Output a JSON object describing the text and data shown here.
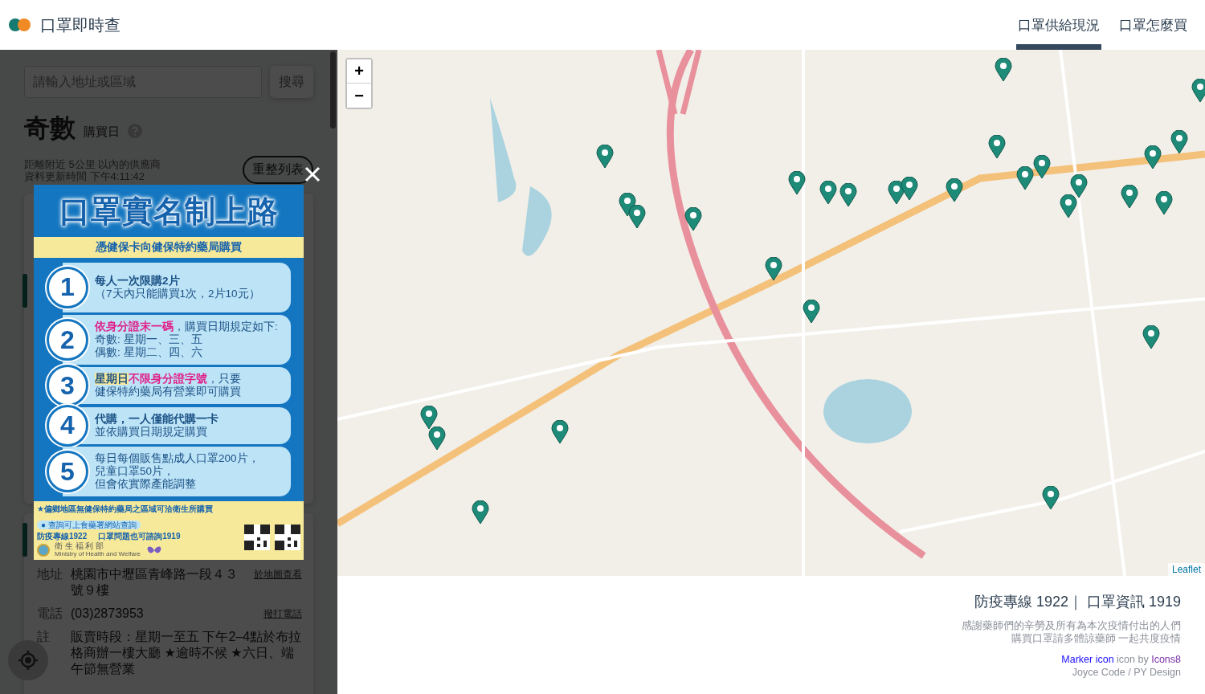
{
  "header": {
    "title": "口罩即時查",
    "nav": [
      {
        "label": "口罩供給現況",
        "selected": true
      },
      {
        "label": "口罩怎麼買",
        "selected": false
      }
    ]
  },
  "sidebar": {
    "search": {
      "placeholder": "請輸入地址或區域",
      "button": "搜尋"
    },
    "day": "奇數",
    "day_label": "購買日",
    "info": [
      "距離附近 5公里 以內的供應商",
      "資料更新時間 下午4:11:42"
    ],
    "refresh": "重整列表",
    "store": {
      "rows": [
        {
          "label": "地址",
          "value": "桃園市中壢區青峰路一段４３號９樓",
          "action": "於地圖查看"
        },
        {
          "label": "電話",
          "value": "(03)2873953",
          "action": "撥打電話"
        },
        {
          "label": "註",
          "value": "販賣時段：星期一至五 下午2–4點於布拉格商辦一樓大廳 ★逾時不候 ★六日、端午節無營業"
        }
      ]
    }
  },
  "modal": {
    "title": "口罩實名制上路",
    "subtitle": "憑健保卡向健保特約藥局購買",
    "items": [
      {
        "number": "1",
        "lines": [
          [
            {
              "text": "每人一次限購2片",
              "kind": "strong"
            }
          ],
          [
            {
              "text": "（7天內只能購買1次，2片10元）",
              "kind": "normal"
            }
          ]
        ]
      },
      {
        "number": "2",
        "lines": [
          [
            {
              "text": "依身分證末一碼",
              "kind": "accent"
            },
            {
              "text": "，購買日期規定如下:",
              "kind": "normal"
            }
          ],
          [
            {
              "text": "奇數: 星期一、三、五",
              "kind": "normal"
            }
          ],
          [
            {
              "text": "偶數: 星期二、四、六",
              "kind": "normal"
            }
          ]
        ]
      },
      {
        "number": "3",
        "lines": [
          [
            {
              "text": "星期日",
              "kind": "highlight"
            },
            {
              "text": "不限身分證字號",
              "kind": "accent"
            },
            {
              "text": "，只要",
              "kind": "normal"
            }
          ],
          [
            {
              "text": "健保特約藥局有營業即可購買",
              "kind": "normal"
            }
          ]
        ]
      },
      {
        "number": "4",
        "lines": [
          [
            {
              "text": "代購，一人僅能代購一卡",
              "kind": "strong"
            }
          ],
          [
            {
              "text": "並依購買日期規定購買",
              "kind": "normal"
            }
          ]
        ]
      },
      {
        "number": "5",
        "lines": [
          [
            {
              "text": "每日每個販售點成人口罩200片，",
              "kind": "normal"
            }
          ],
          [
            {
              "text": "兒童口罩50片，",
              "kind": "normal"
            }
          ],
          [
            {
              "text": "但會依實際產能調整",
              "kind": "normal"
            }
          ]
        ]
      }
    ],
    "note": "★偏鄉地區無健保特約藥局之區域可洽衛生所購買",
    "note_tag": "● 查詢可上食藥署網站查詢",
    "hotlines": [
      "防疫專線1922",
      "口罩問題也可諮詢1919"
    ],
    "ministry": "衛 生 福 利 部",
    "ministry_en": "Ministry of Health and Welfare"
  },
  "map": {
    "zoom": [
      "+",
      "−"
    ],
    "attribution": "Leaflet"
  },
  "footer": {
    "hotline": "防疫專線 1922｜ 口罩資訊 1919",
    "thanks": [
      "感謝藥師們的辛勞及所有為本次疫情付出的人們",
      "購買口罩請多體諒藥師 一起共度疫情"
    ],
    "credit": {
      "link": "Marker icon",
      "middle": " icon by ",
      "author": "Icons8"
    },
    "authors": "Joyce Code / PY Design"
  }
}
